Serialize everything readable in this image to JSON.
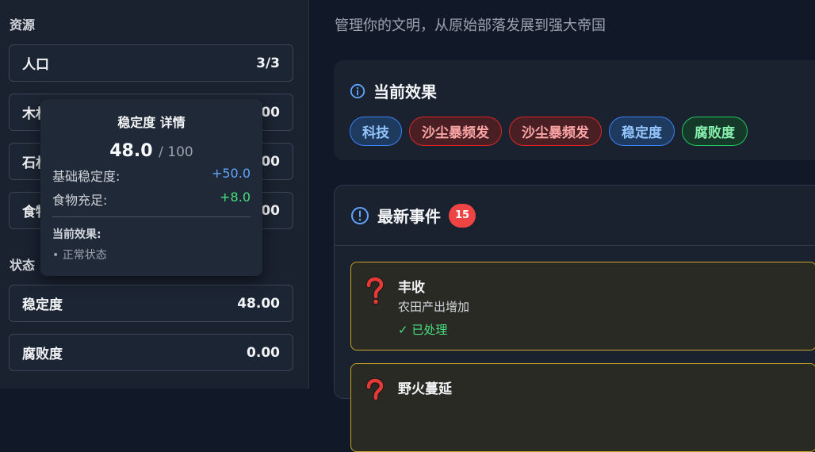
{
  "sidebar": {
    "resources_title": "资源",
    "resources": [
      {
        "label": "人口",
        "value": "3/3"
      },
      {
        "label": "木材",
        "value": "00"
      },
      {
        "label": "石材",
        "value": "00"
      },
      {
        "label": "食物",
        "value": "00"
      }
    ],
    "status_title": "状态",
    "status": [
      {
        "label": "稳定度",
        "value": "48.00"
      },
      {
        "label": "腐败度",
        "value": "0.00"
      }
    ]
  },
  "tooltip": {
    "title": "稳定度 详情",
    "value": "48.0",
    "max": "/ 100",
    "rows": [
      {
        "label": "基础稳定度:",
        "value": "+50.0",
        "color": "#60a5fa"
      },
      {
        "label": "食物充足:",
        "value": "+8.0",
        "color": "#4ade80"
      }
    ],
    "effects_title": "当前效果:",
    "effects": [
      "• 正常状态"
    ]
  },
  "main": {
    "subtitle": "管理你的文明，从原始部落发展到强大帝国",
    "effects_card": {
      "title": "当前效果",
      "icon": "info-circle-icon",
      "tags": [
        {
          "label": "科技",
          "color": "blue"
        },
        {
          "label": "沙尘暴频发",
          "color": "red"
        },
        {
          "label": "沙尘暴频发",
          "color": "red"
        },
        {
          "label": "稳定度",
          "color": "blue"
        },
        {
          "label": "腐败度",
          "color": "green"
        }
      ]
    },
    "events_card": {
      "title": "最新事件",
      "icon": "alert-circle-icon",
      "count": "15",
      "events": [
        {
          "title": "丰收",
          "desc": "农田产出增加",
          "status": "✓ 已处理",
          "icon": "question-mark-icon"
        },
        {
          "title": "野火蔓延",
          "desc": "",
          "status": "",
          "icon": "question-mark-icon"
        }
      ]
    }
  },
  "colors": {
    "blue_tag_bg": "#1e3a5f",
    "blue_tag_border": "#3b82f6",
    "blue_tag_text": "#93c5fd",
    "red_tag_bg": "#4a1f24",
    "red_tag_border": "#dc2626",
    "red_tag_text": "#fca5a5",
    "green_tag_bg": "#163a2a",
    "green_tag_border": "#22c55e",
    "green_tag_text": "#86efac",
    "event_border": "#c9a227",
    "badge": "#ef4444"
  }
}
